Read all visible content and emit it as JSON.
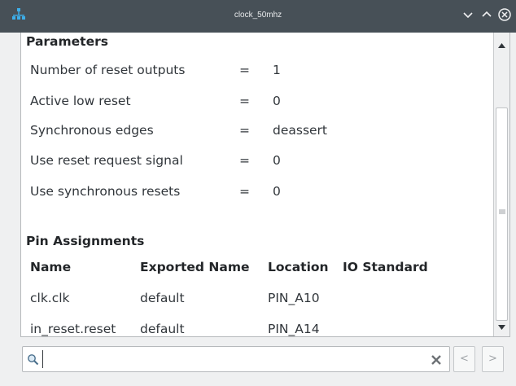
{
  "window": {
    "title": "clock_50mhz",
    "app_icon": "network-tree-icon",
    "controls": [
      "minimize-chevron-icon",
      "maximize-chevron-icon",
      "close-icon"
    ]
  },
  "parameters": {
    "heading": "Parameters",
    "rows": [
      {
        "name": "Number of reset outputs",
        "eq": "=",
        "value": "1"
      },
      {
        "name": "Active low reset",
        "eq": "=",
        "value": "0"
      },
      {
        "name": "Synchronous edges",
        "eq": "=",
        "value": "deassert"
      },
      {
        "name": "Use reset request signal",
        "eq": "=",
        "value": "0"
      },
      {
        "name": "Use synchronous resets",
        "eq": "=",
        "value": "0"
      }
    ]
  },
  "pin_assignments": {
    "heading": "Pin Assignments",
    "columns": [
      "Name",
      "Exported Name",
      "Location",
      "IO Standard"
    ],
    "rows": [
      [
        "clk.clk",
        "default",
        "PIN_A10",
        ""
      ],
      [
        "in_reset.reset",
        "default",
        "PIN_A14",
        ""
      ]
    ]
  },
  "search": {
    "value": "",
    "placeholder": "",
    "icon": "search-icon",
    "clear_icon": "clear-icon"
  },
  "nav": {
    "prev_label": "<",
    "next_label": ">"
  },
  "colors": {
    "titlebar": "#475057",
    "accent": "#3daee9",
    "content_bg": "#ffffff",
    "window_bg": "#eff0f1"
  }
}
